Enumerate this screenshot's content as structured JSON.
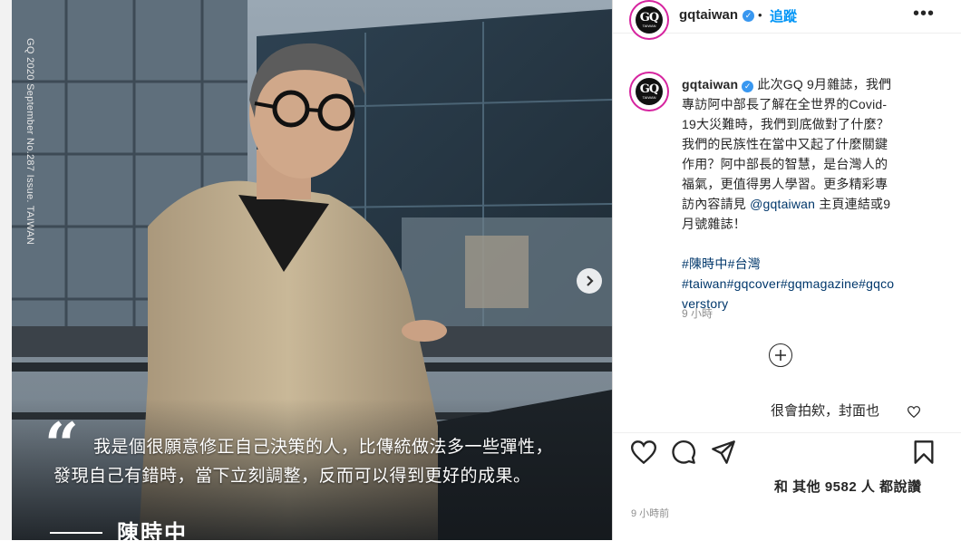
{
  "photo": {
    "side_caption": "GQ 2020 September No.287 Issue. TAIWAN",
    "quote_mark": "“",
    "quote_line_1": "我是個很願意修正自己決策的人，比傳統做法多一些彈性，",
    "quote_line_2": "發現自己有錯時，當下立刻調整，反而可以得到更好的成果。",
    "signature": "陳時中"
  },
  "header": {
    "avatar_logo": "GQ",
    "avatar_sub": "TAIWAN",
    "username": "gqtaiwan",
    "separator": "•",
    "follow_label": "追蹤",
    "more_label": "•••"
  },
  "caption": {
    "username": "gqtaiwan",
    "lines": [
      " 此次GQ 9月雜誌，我們",
      "專訪阿中部長了解在全世界的Covid-",
      "19大災難時，我們到底做對了什麼？",
      "我們的民族性在當中又起了什麼關鍵",
      "作用？阿中部長的智慧，是台灣人的",
      "福氣，更值得男人學習。更多精彩專"
    ],
    "line7_pre": "訪內容請見 ",
    "mention": "@gqtaiwan",
    "line7_post": " 主頁連結或9",
    "line8": "月號雜誌！",
    "hashtags": [
      "#陳時中#台灣",
      "#taiwan#gqcover#gqmagazine#gqco",
      "verstory"
    ],
    "time": "9 小時"
  },
  "comment": {
    "text": "很會拍欸，封面也"
  },
  "actions": {
    "likes": "和 其他 9582 人 都說讚",
    "date": "9 小時前"
  },
  "colors": {
    "link": "#00376b",
    "follow": "#0095f6",
    "verified": "#3897f0"
  }
}
